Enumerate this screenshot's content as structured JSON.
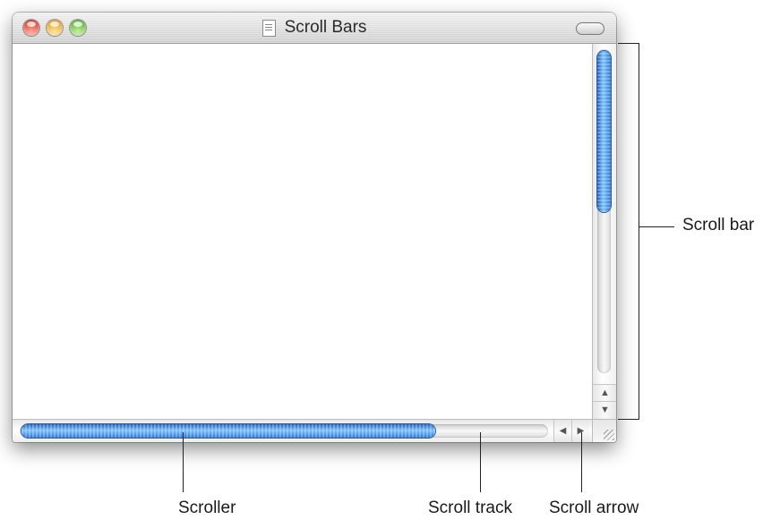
{
  "window": {
    "title": "Scroll Bars"
  },
  "vertical_scrollbar": {
    "up_arrow": "▲",
    "down_arrow": "▼",
    "thumb_position": 0.0,
    "thumb_proportion": 0.45
  },
  "horizontal_scrollbar": {
    "left_arrow": "◀",
    "right_arrow": "▶",
    "thumb_position": 0.0,
    "thumb_proportion": 0.78
  },
  "callouts": {
    "scroll_bar": "Scroll bar",
    "scroller": "Scroller",
    "scroll_track": "Scroll track",
    "scroll_arrow": "Scroll arrow"
  },
  "colors": {
    "thumb": "#4a9ae8",
    "close": "#e0402e",
    "minimize": "#f0a21e",
    "zoom": "#5cbb35"
  }
}
